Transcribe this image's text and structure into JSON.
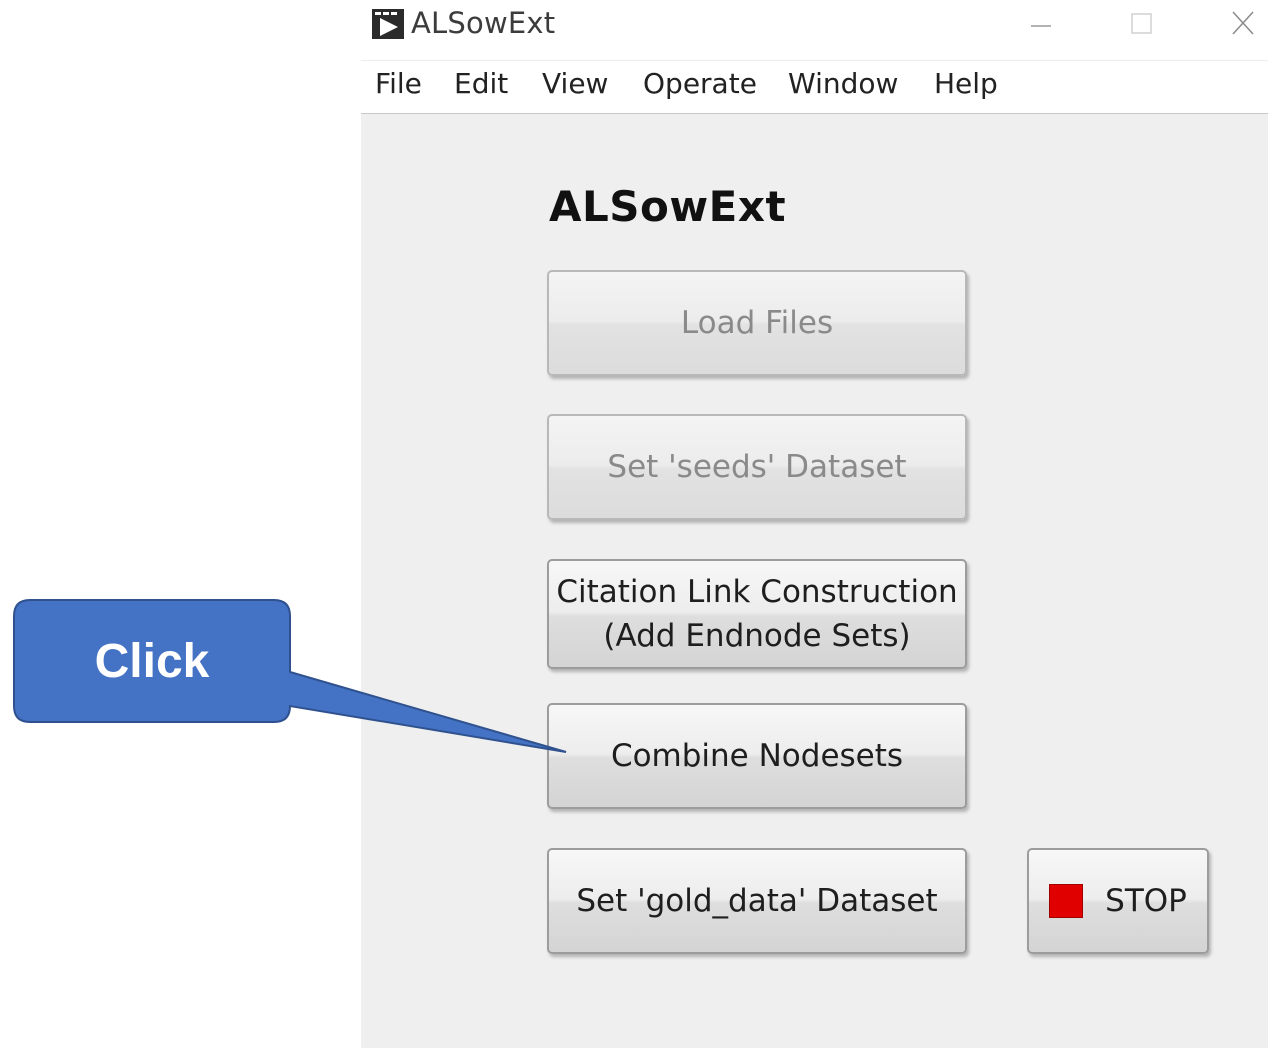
{
  "window": {
    "title": "ALSowExt"
  },
  "menu": {
    "items": [
      "File",
      "Edit",
      "View",
      "Operate",
      "Window",
      "Help"
    ]
  },
  "panel": {
    "title": "ALSowExt",
    "buttons": {
      "load_files": "Load Files",
      "set_seeds": "Set 'seeds' Dataset",
      "citation_line1": "Citation Link Construction",
      "citation_line2": "(Add Endnode Sets)",
      "combine_nodesets": "Combine Nodesets",
      "set_gold_data": "Set 'gold_data' Dataset",
      "stop": "STOP"
    },
    "disabled_buttons": [
      "Load Files",
      "Set 'seeds' Dataset"
    ]
  },
  "callout": {
    "label": "Click",
    "fill_color": "#4472c4",
    "border_color": "#2f528f"
  },
  "colors": {
    "stop_indicator": "#e00000",
    "panel_background": "#efefef"
  }
}
